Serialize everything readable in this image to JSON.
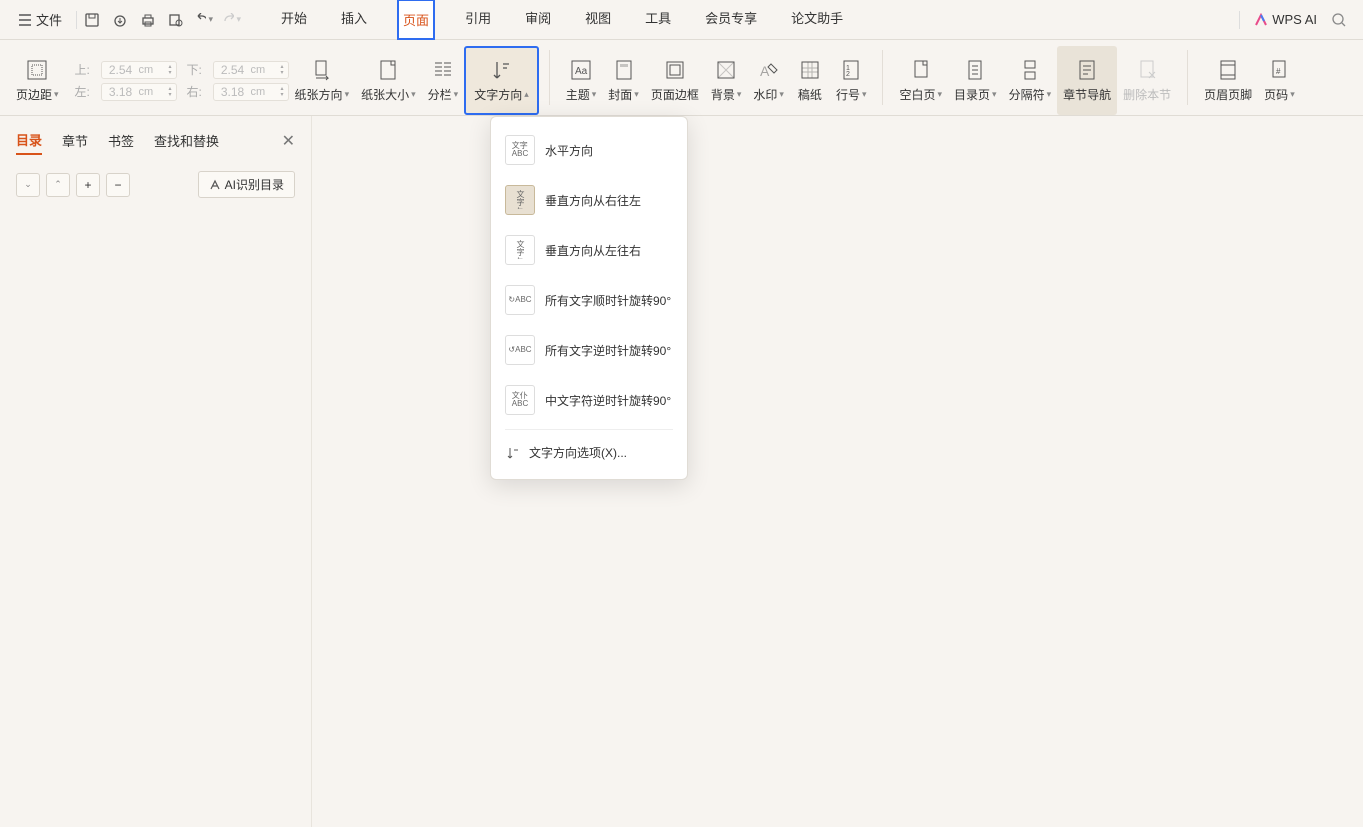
{
  "menubar": {
    "file_label": "文件",
    "tabs": [
      "开始",
      "插入",
      "页面",
      "引用",
      "审阅",
      "视图",
      "工具",
      "会员专享",
      "论文助手"
    ],
    "active_tab": 2,
    "wps_ai_label": "WPS AI"
  },
  "ribbon": {
    "page_margin": {
      "label": "页边距"
    },
    "margins": {
      "top_label": "上:",
      "top_value": "2.54",
      "top_unit": "cm",
      "bottom_label": "下:",
      "bottom_value": "2.54",
      "bottom_unit": "cm",
      "left_label": "左:",
      "left_value": "3.18",
      "left_unit": "cm",
      "right_label": "右:",
      "right_value": "3.18",
      "right_unit": "cm"
    },
    "paper_orient": "纸张方向",
    "paper_size": "纸张大小",
    "columns": "分栏",
    "text_direction": "文字方向",
    "theme": "主题",
    "cover": "封面",
    "page_border": "页面边框",
    "background": "背景",
    "watermark": "水印",
    "manus": "稿纸",
    "line_no": "行号",
    "blank_page": "空白页",
    "toc_page": "目录页",
    "separator": "分隔符",
    "chapter_nav": "章节导航",
    "delete_section": "删除本节",
    "header_footer": "页眉页脚",
    "page_no": "页码"
  },
  "sidebar": {
    "tabs": [
      "目录",
      "章节",
      "书签",
      "查找和替换"
    ],
    "active": 0,
    "ai_btn": "AI识别目录"
  },
  "dropdown": {
    "items": [
      "水平方向",
      "垂直方向从右往左",
      "垂直方向从左往右",
      "所有文字顺时针旋转90°",
      "所有文字逆时针旋转90°",
      "中文字符逆时针旋转90°"
    ],
    "selected": 1,
    "options": "文字方向选项(X)..."
  }
}
